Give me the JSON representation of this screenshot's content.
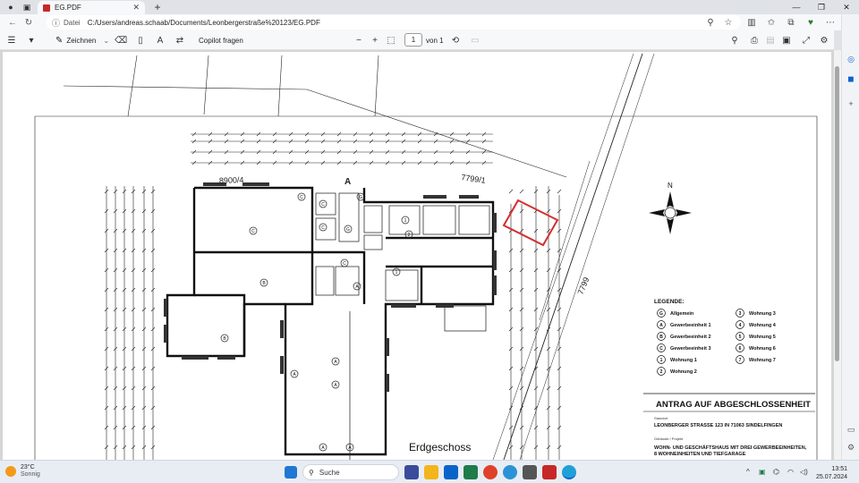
{
  "browser": {
    "tab_title": "EG.PDF",
    "tab_close": "✕",
    "new_tab": "+",
    "address_label": "Datei",
    "url": "C:/Users/andreas.schaab/Documents/Leonbergerstraße%20123/EG.PDF",
    "window_controls": [
      "—",
      "❐",
      "✕"
    ]
  },
  "pdf_toolbar": {
    "draw_label": "Zeichnen",
    "copilot_label": "Copilot fragen",
    "zoom_out": "−",
    "zoom_in": "+",
    "page_current": "1",
    "page_total": "von 1"
  },
  "drawing": {
    "parcel_a": "8900/4",
    "parcel_b": "7799/1",
    "road": "7799",
    "section_mark": "A",
    "north": "N",
    "floor_label": "Erdgeschoss",
    "legend_title": "LEGENDE:",
    "legend": [
      {
        "sym": "G",
        "label": "Allgemein"
      },
      {
        "sym": "A",
        "label": "Gewerbeeinheit 1"
      },
      {
        "sym": "B",
        "label": "Gewerbeeinheit 2"
      },
      {
        "sym": "C",
        "label": "Gewerbeeinheit 3"
      },
      {
        "sym": "1",
        "label": "Wohnung 1"
      },
      {
        "sym": "2",
        "label": "Wohnung 2"
      },
      {
        "sym": "3",
        "label": "Wohnung 3"
      },
      {
        "sym": "4",
        "label": "Wohnung 4"
      },
      {
        "sym": "5",
        "label": "Wohnung 5"
      },
      {
        "sym": "6",
        "label": "Wohnung 6"
      },
      {
        "sym": "7",
        "label": "Wohnung 7"
      }
    ],
    "stamp_title": "ANTRAG AUF ABGESCHLOSSENHEIT",
    "stamp_lines": [
      "Standort",
      "LEONBERGER STRASSE 123 IN 71063 SINDELFINGEN",
      "Gebäude / Projekt",
      "WOHN- UND GESCHÄFTSHAUS MIT DREI GEWERBEEINHEITEN,",
      "8 WOHNEINHEITEN UND TIEFGARAGE"
    ]
  },
  "taskbar": {
    "temperature": "23°C",
    "weather": "Sonnig",
    "search_placeholder": "Suche",
    "time": "13:51",
    "date": "25.07.2024"
  },
  "colors": {
    "accent": "#0a64c8",
    "highlight": "#d32f2f",
    "pdf_red": "#c62828"
  }
}
